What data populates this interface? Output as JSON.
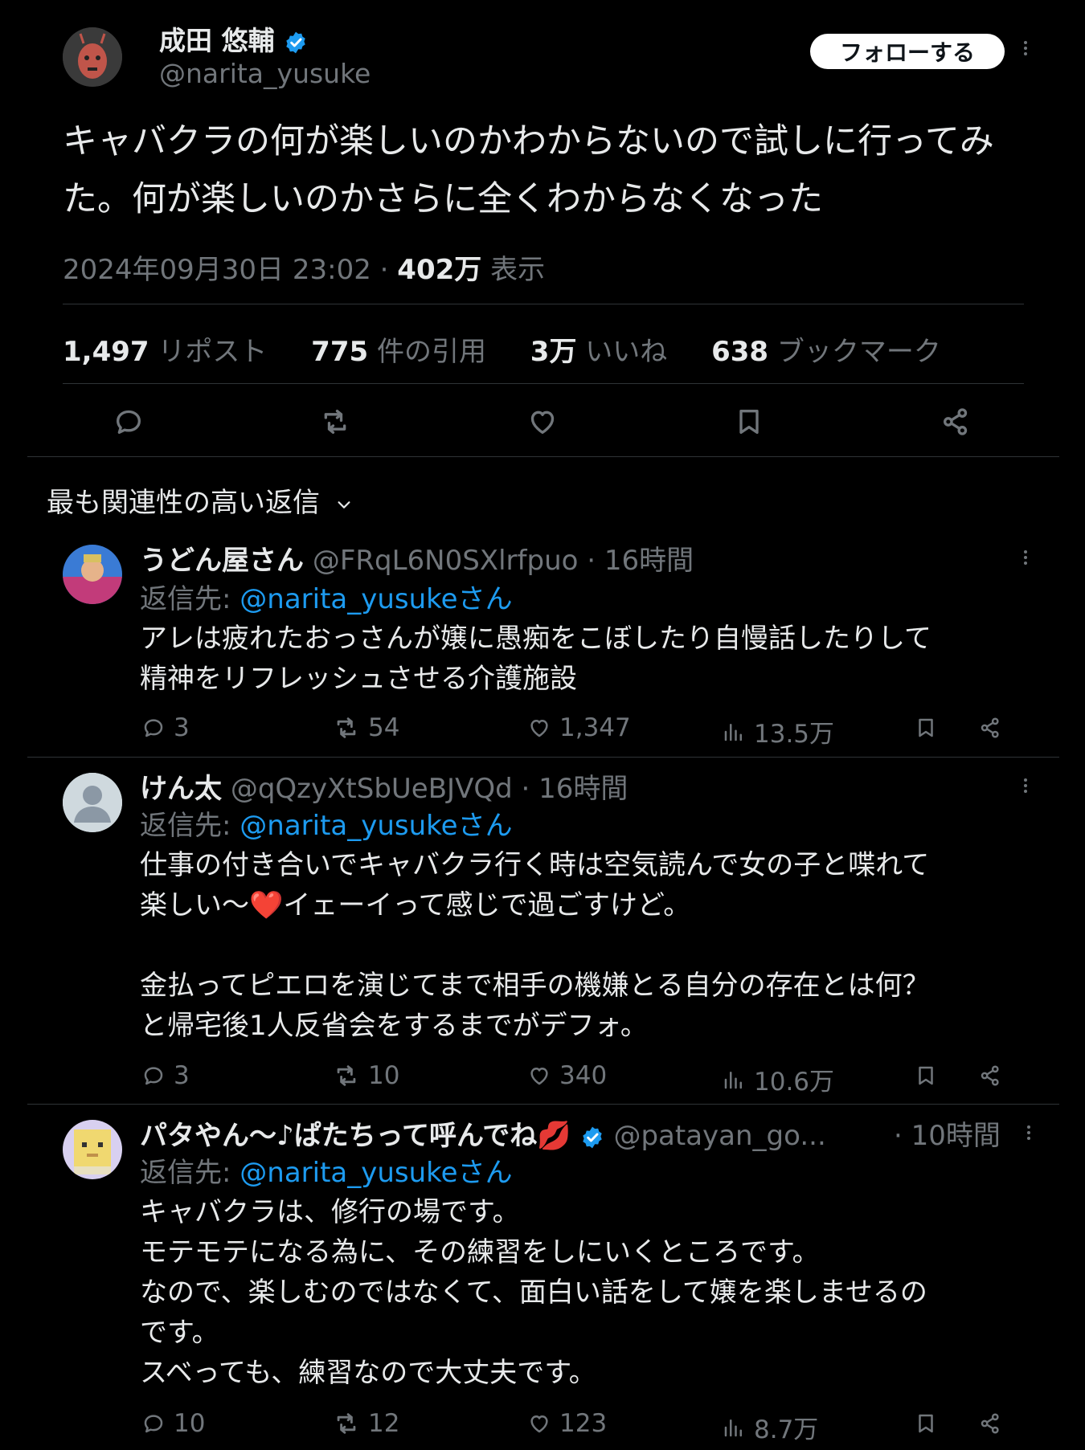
{
  "main": {
    "name": "成田 悠輔",
    "handle": "@narita_yusuke",
    "follow_label": "フォローする",
    "text": "キャバクラの何が楽しいのかわからないので試しに行ってみた。何が楽しいのかさらに全くわからなくなった",
    "timestamp": "2024年09月30日 23:02",
    "views_count": "402万",
    "views_label": "表示",
    "stats": [
      {
        "num": "1,497",
        "label": "リポスト"
      },
      {
        "num": "775",
        "label": "件の引用"
      },
      {
        "num": "3万",
        "label": "いいね"
      },
      {
        "num": "638",
        "label": "ブックマーク"
      }
    ]
  },
  "sort_label": "最も関連性の高い返信",
  "replies": [
    {
      "name": "うどん屋さん",
      "handle": "@FRqL6N0SXlrfpuo",
      "time": "· 16時間",
      "reply_to_prefix": "返信先: ",
      "reply_to": "@narita_yusukeさん",
      "text": "アレは疲れたおっさんが嬢に愚痴をこぼしたり自慢話したりして\n精神をリフレッシュさせる介護施設",
      "replies": "3",
      "reposts": "54",
      "likes": "1,347",
      "views": "13.5万"
    },
    {
      "name": "けん太",
      "handle": "@qQzyXtSbUeBJVQd",
      "time": "· 16時間",
      "reply_to_prefix": "返信先: ",
      "reply_to": "@narita_yusukeさん",
      "text": "仕事の付き合いでキャバクラ行く時は空気読んで女の子と喋れて\n楽しい〜❤️イェーイって感じで過ごすけど。\n\n金払ってピエロを演じてまで相手の機嫌とる自分の存在とは何？\nと帰宅後1人反省会をするまでがデフォ。",
      "replies": "3",
      "reposts": "10",
      "likes": "340",
      "views": "10.6万"
    },
    {
      "name": "パタやん〜♪ぱたちって呼んでね💋",
      "handle": "@patayan_go...",
      "time": "· 10時間",
      "reply_to_prefix": "返信先: ",
      "reply_to": "@narita_yusukeさん",
      "text": "キャバクラは、修行の場です。\nモテモテになる為に、その練習をしにいくところです。\nなので、楽しむのではなくて、面白い話をして嬢を楽しませるの\nです。\nスベっても、練習なので大丈夫です。",
      "replies": "10",
      "reposts": "12",
      "likes": "123",
      "views": "8.7万"
    }
  ],
  "colors": {
    "accent": "#1d9bf0",
    "muted": "#71767b",
    "text": "#e7e9ea",
    "bg": "#000000"
  }
}
